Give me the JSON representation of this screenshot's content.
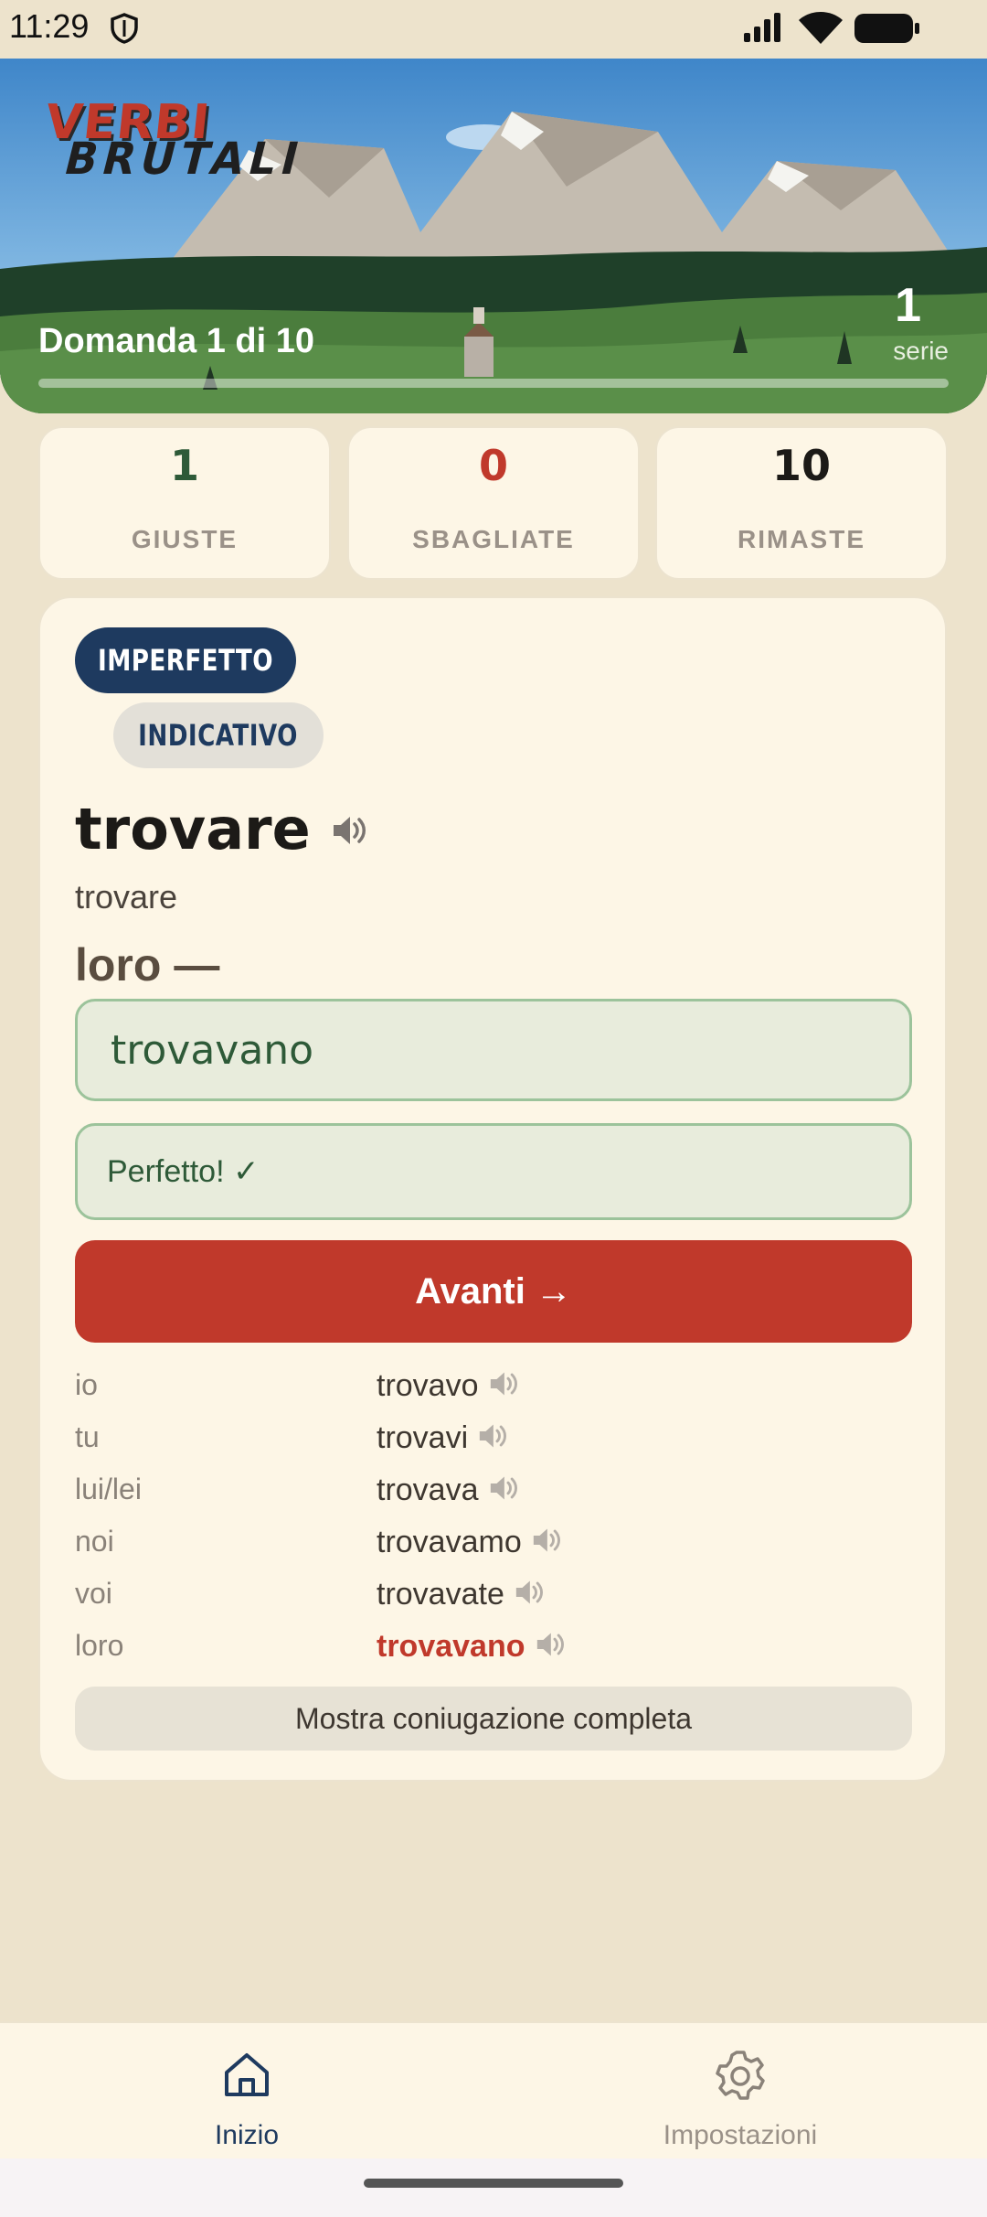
{
  "status_bar": {
    "time": "11:29"
  },
  "header": {
    "logo_line1": "VERBI",
    "logo_line2": "BRUTALI",
    "question_label": "Domanda 1 di 10",
    "streak_count": "1",
    "streak_label": "serie",
    "progress_fraction": 0.0
  },
  "stats": {
    "correct": {
      "value": "1",
      "label": "GIUSTE",
      "color": "#2e5a38"
    },
    "wrong": {
      "value": "0",
      "label": "SBAGLIATE",
      "color": "#c0392b"
    },
    "remaining": {
      "value": "10",
      "label": "RIMASTE",
      "color": "#1c1a17"
    }
  },
  "question": {
    "tense": "IMPERFETTO",
    "mood": "INDICATIVO",
    "verb": "trovare",
    "translation": "trovare",
    "prompt": "loro —",
    "answer": "trovavano",
    "feedback": "Perfetto! ✓",
    "next_label": "Avanti →"
  },
  "conjugation": [
    {
      "pronoun": "io",
      "form": "trovavo",
      "highlight": false
    },
    {
      "pronoun": "tu",
      "form": "trovavi",
      "highlight": false
    },
    {
      "pronoun": "lui/lei",
      "form": "trovava",
      "highlight": false
    },
    {
      "pronoun": "noi",
      "form": "trovavamo",
      "highlight": false
    },
    {
      "pronoun": "voi",
      "form": "trovavate",
      "highlight": false
    },
    {
      "pronoun": "loro",
      "form": "trovavano",
      "highlight": true
    }
  ],
  "show_all_label": "Mostra coniugazione completa",
  "nav": {
    "home": {
      "label": "Inizio",
      "icon": "home-icon",
      "active": true
    },
    "settings": {
      "label": "Impostazioni",
      "icon": "gear-icon",
      "active": false
    }
  },
  "colors": {
    "brand_red": "#c0392b",
    "navy": "#1e3a5f",
    "success_green": "#2e5a38",
    "background": "#ede3cc"
  }
}
